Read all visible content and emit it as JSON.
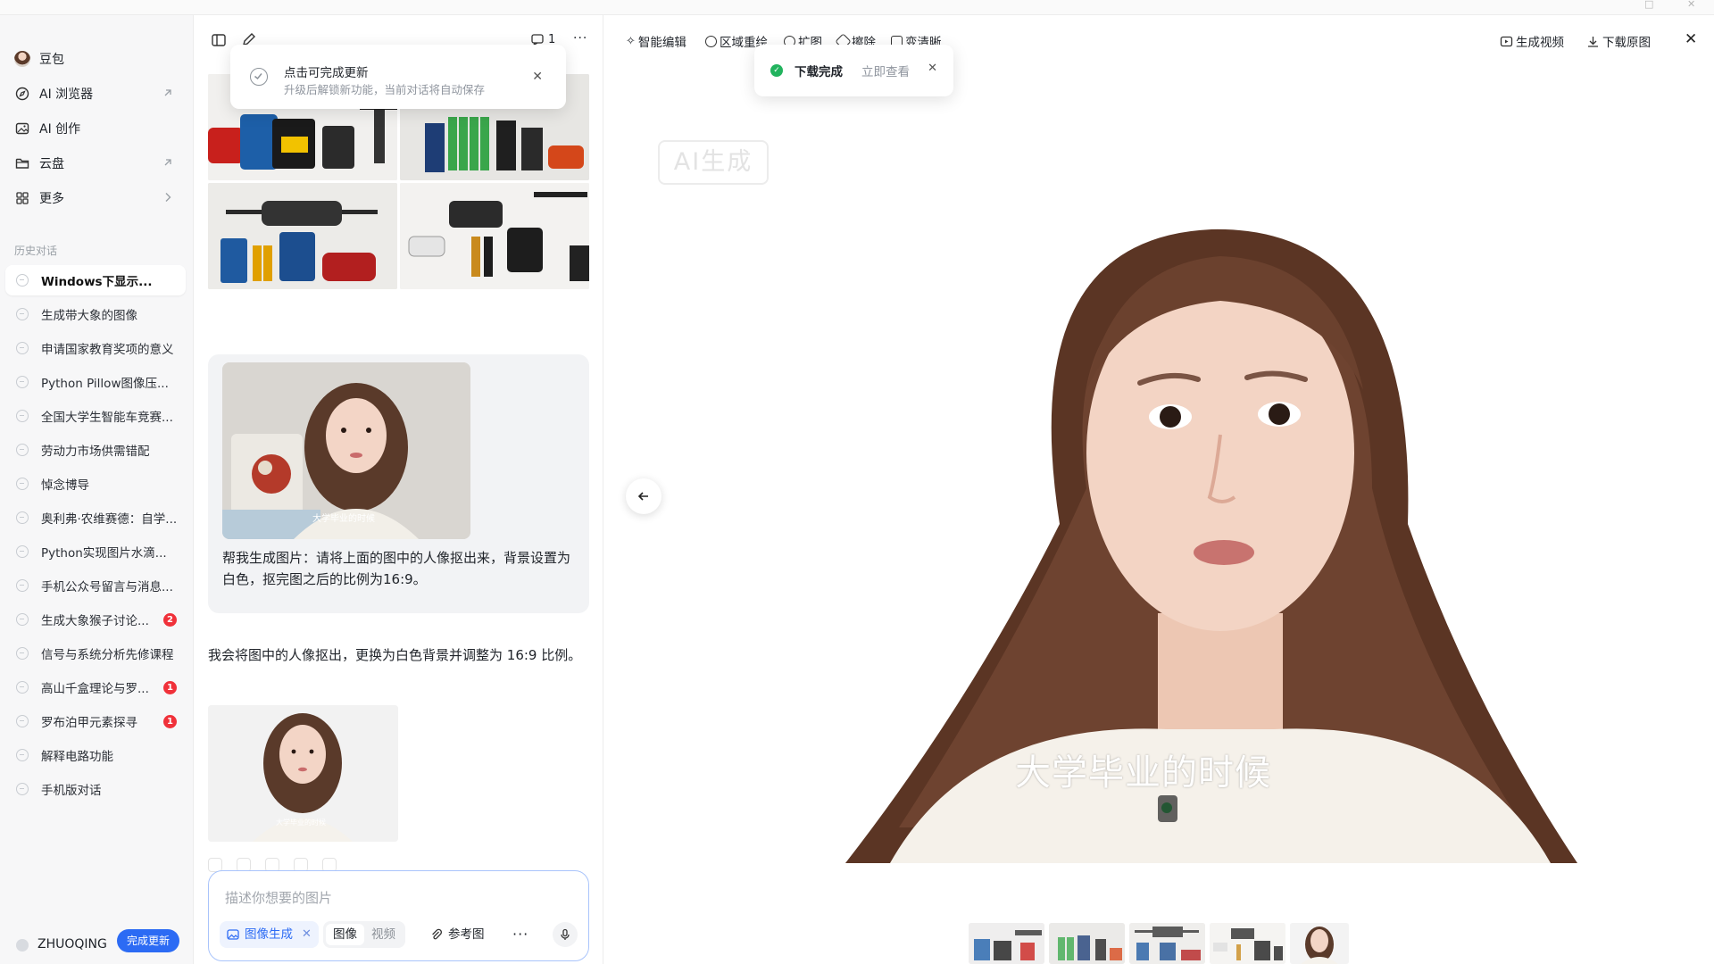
{
  "sidebar": {
    "nav": [
      {
        "label": "豆包",
        "icon": "avatar-icon"
      },
      {
        "label": "AI 浏览器",
        "icon": "compass-icon",
        "arrow": "external-arrow-icon"
      },
      {
        "label": "AI 创作",
        "icon": "image-icon"
      },
      {
        "label": "云盘",
        "icon": "folder-icon",
        "arrow": "external-arrow-icon"
      },
      {
        "label": "更多",
        "icon": "grid-icon",
        "arrow": "chevron-right-icon"
      }
    ],
    "history_title": "历史对话",
    "history": [
      {
        "label": "Windows下显示...",
        "active": true
      },
      {
        "label": "生成带大象的图像"
      },
      {
        "label": "申请国家教育奖项的意义"
      },
      {
        "label": "Python Pillow图像压..."
      },
      {
        "label": "全国大学生智能车竞赛..."
      },
      {
        "label": "劳动力市场供需错配"
      },
      {
        "label": "悼念博导"
      },
      {
        "label": "奥利弗·农维赛德：自学..."
      },
      {
        "label": "Python实现图片水滴..."
      },
      {
        "label": "手机公众号留言与消息..."
      },
      {
        "label": "生成大象猴子讨论...",
        "badge": "2"
      },
      {
        "label": "信号与系统分析先修课程"
      },
      {
        "label": "高山千盒理论与罗...",
        "badge": "1"
      },
      {
        "label": "罗布泊甲元素探寻",
        "badge": "1"
      },
      {
        "label": "解释电路功能"
      },
      {
        "label": "手机版对话"
      }
    ],
    "user": {
      "name": "ZHUOQING",
      "update_button": "完成更新"
    }
  },
  "chat": {
    "toolbar": {
      "count": "1"
    },
    "toast": {
      "title": "点击可完成更新",
      "subtitle": "升级后解锁新功能，当前对话将自动保存"
    },
    "user_message": {
      "text": "帮我生成图片：请将上面的图中的人像抠出来，背景设置为白色，抠完图之后的比例为16:9。",
      "thumb_caption": "大学毕业的时候"
    },
    "bot_message": {
      "text": "我会将图中的人像抠出，更换为白色背景并调整为 16:9 比例。",
      "thumb_caption": "大学毕业的时候"
    },
    "input": {
      "placeholder": "描述你想要的图片",
      "chip_generate": "图像生成",
      "mode_image": "图像",
      "mode_video": "视频",
      "reference": "参考图",
      "more": "···"
    }
  },
  "preview": {
    "tools": [
      "智能编辑",
      "区域重绘",
      "扩图",
      "擦除",
      "变清晰"
    ],
    "right_tools": [
      "生成视频",
      "下载原图"
    ],
    "toast": {
      "title": "下载完成",
      "action": "立即查看"
    },
    "watermark": "AI生成",
    "caption": "大学毕业的时候"
  },
  "colors": {
    "accent": "#2c6bf4",
    "success": "#22b35e",
    "badge": "#f0313a",
    "sidebar_bg": "#f7f7f8"
  }
}
